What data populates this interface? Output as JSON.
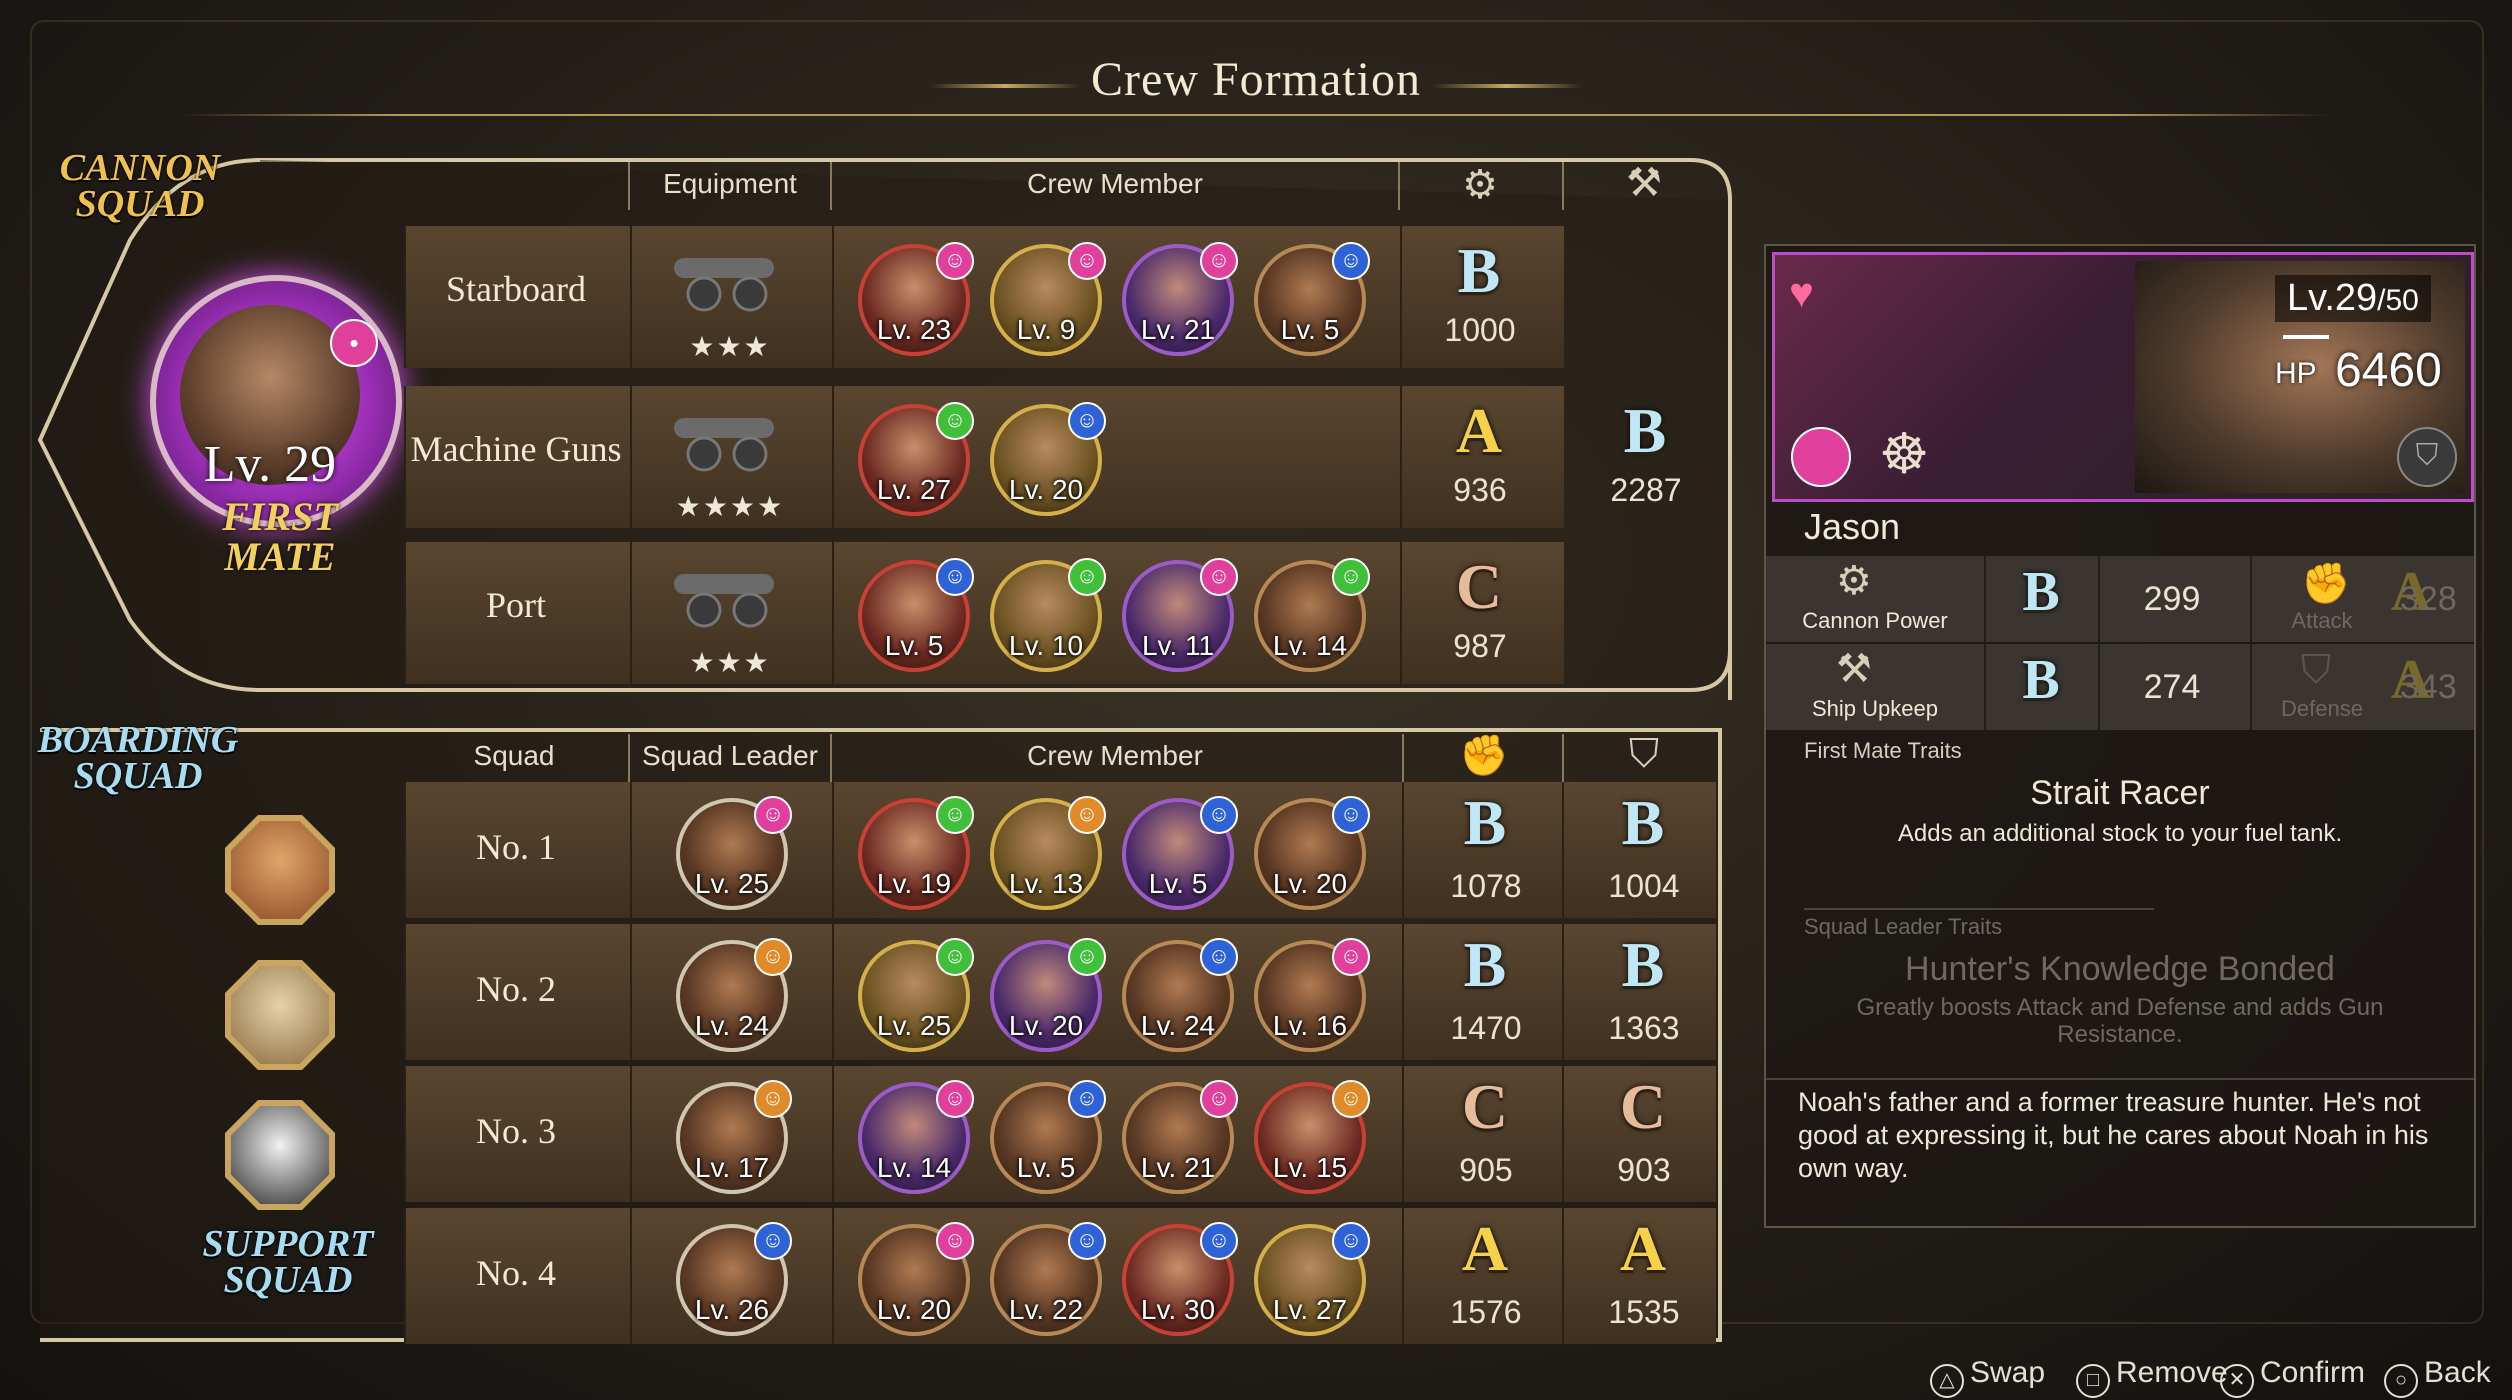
{
  "title": "Crew Formation",
  "cannon_squad": {
    "tag": "CANNON SQUAD",
    "headers": {
      "equipment": "Equipment",
      "crew_member": "Crew Member"
    },
    "first_mate": {
      "level": "Lv. 29",
      "badge": "FIRST MATE"
    },
    "rows": [
      {
        "name": "Starboard",
        "stars": "★★★",
        "grade": "B",
        "value": "1000",
        "crew": [
          {
            "lv": "Lv. 23",
            "mood": "pink"
          },
          {
            "lv": "Lv. 9",
            "mood": "pink"
          },
          {
            "lv": "Lv. 21",
            "mood": "pink"
          },
          {
            "lv": "Lv. 5",
            "mood": "blue"
          }
        ]
      },
      {
        "name": "Machine Guns",
        "stars": "★★★★",
        "grade": "A",
        "value": "936",
        "grade2": "B",
        "value2": "2287",
        "crew": [
          {
            "lv": "Lv. 27",
            "mood": "green"
          },
          {
            "lv": "Lv. 20",
            "mood": "blue"
          }
        ]
      },
      {
        "name": "Port",
        "stars": "★★★",
        "grade": "C",
        "value": "987",
        "crew": [
          {
            "lv": "Lv. 5",
            "mood": "blue"
          },
          {
            "lv": "Lv. 10",
            "mood": "green"
          },
          {
            "lv": "Lv. 11",
            "mood": "pink"
          },
          {
            "lv": "Lv. 14",
            "mood": "green"
          }
        ]
      }
    ]
  },
  "boarding_squad": {
    "tag": "BOARDING SQUAD",
    "headers": {
      "squad": "Squad",
      "squad_leader": "Squad Leader",
      "crew_member": "Crew Member"
    },
    "rows": [
      {
        "name": "No. 1",
        "leader": {
          "lv": "Lv. 25",
          "mood": "pink"
        },
        "grade_atk": "B",
        "atk": "1078",
        "grade_def": "B",
        "def": "1004",
        "crew": [
          {
            "lv": "Lv. 19",
            "mood": "green"
          },
          {
            "lv": "Lv. 13",
            "mood": "orange"
          },
          {
            "lv": "Lv. 5",
            "mood": "blue"
          },
          {
            "lv": "Lv. 20",
            "mood": "blue"
          }
        ]
      },
      {
        "name": "No. 2",
        "leader": {
          "lv": "Lv. 24",
          "mood": "orange"
        },
        "grade_atk": "B",
        "atk": "1470",
        "grade_def": "B",
        "def": "1363",
        "crew": [
          {
            "lv": "Lv. 25",
            "mood": "green"
          },
          {
            "lv": "Lv. 20",
            "mood": "green"
          },
          {
            "lv": "Lv. 24",
            "mood": "blue"
          },
          {
            "lv": "Lv. 16",
            "mood": "pink"
          }
        ]
      },
      {
        "name": "No. 3",
        "leader": {
          "lv": "Lv. 17",
          "mood": "orange"
        },
        "grade_atk": "C",
        "atk": "905",
        "grade_def": "C",
        "def": "903",
        "crew": [
          {
            "lv": "Lv. 14",
            "mood": "pink"
          },
          {
            "lv": "Lv. 5",
            "mood": "blue"
          },
          {
            "lv": "Lv. 21",
            "mood": "pink"
          },
          {
            "lv": "Lv. 15",
            "mood": "orange"
          }
        ]
      },
      {
        "name": "No. 4",
        "leader": {
          "lv": "Lv. 26",
          "mood": "blue"
        },
        "grade_atk": "A",
        "atk": "1576",
        "grade_def": "A",
        "def": "1535",
        "crew": [
          {
            "lv": "Lv. 20",
            "mood": "pink"
          },
          {
            "lv": "Lv. 22",
            "mood": "blue"
          },
          {
            "lv": "Lv. 30",
            "mood": "blue"
          },
          {
            "lv": "Lv. 27",
            "mood": "blue"
          }
        ]
      }
    ]
  },
  "support_squad": {
    "tag": "SUPPORT SQUAD"
  },
  "detail": {
    "level": "Lv.29",
    "level_max": "/50",
    "hp_label": "HP",
    "hp": "6460",
    "name": "Jason",
    "stats": [
      {
        "label": "Cannon Power",
        "grade": "B",
        "value": "299",
        "label2": "Attack",
        "grade2": "A",
        "value2": "328"
      },
      {
        "label": "Ship Upkeep",
        "grade": "B",
        "value": "274",
        "label2": "Defense",
        "grade2": "A",
        "value2": "343"
      }
    ],
    "first_mate_traits_label": "First Mate Traits",
    "first_mate_trait_name": "Strait Racer",
    "first_mate_trait_desc": "Adds an additional stock to your fuel tank.",
    "squad_leader_traits_label": "Squad Leader Traits",
    "squad_leader_trait_name": "Hunter's Knowledge Bonded",
    "squad_leader_trait_desc": "Greatly boosts Attack and Defense and adds Gun Resistance.",
    "bio": "Noah's father and a former treasure hunter. He's not good at expressing it, but he cares about Noah in his own way."
  },
  "controls": [
    {
      "glyph": "△",
      "label": "Swap"
    },
    {
      "glyph": "□",
      "label": "Remove"
    },
    {
      "glyph": "✕",
      "label": "Confirm"
    },
    {
      "glyph": "○",
      "label": "Back"
    }
  ],
  "colors": {
    "grade_A": "#f6d24b",
    "grade_B": "#bfe7f5",
    "grade_C": "#e7bb99",
    "mood_pink": "#e0409b",
    "mood_green": "#3fbf3a",
    "mood_blue": "#2e62d6",
    "mood_orange": "#e08a2a"
  }
}
